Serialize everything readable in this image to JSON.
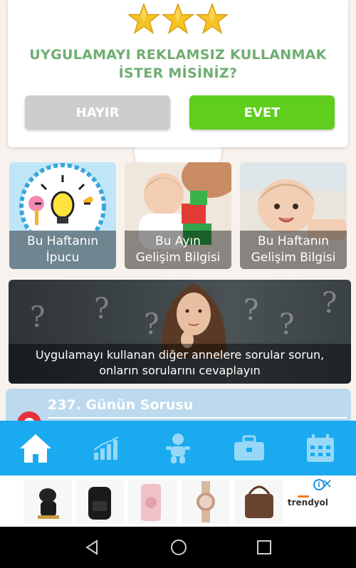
{
  "rating": {
    "star_count": 3,
    "star_color": "#f4c324",
    "question_line1": "UYGULAMAYI REKLAMSIZ KULLANMAK",
    "question_line2": "İSTER MİSİNİZ?",
    "no_label": "HAYIR",
    "yes_label": "EVET"
  },
  "tiles": [
    {
      "line1": "Bu Haftanın",
      "line2": "İpucu",
      "icon": "lightbulb-icon"
    },
    {
      "line1": "Bu Ayın",
      "line2": "Gelişim Bilgisi",
      "icon": "baby-blocks-photo"
    },
    {
      "line1": "Bu Haftanın",
      "line2": "Gelişim Bilgisi",
      "icon": "baby-photo"
    }
  ],
  "banner": {
    "line1": "Uygulamayı kullanan diğer annelere sorular sorun,",
    "line2": "onların sorularını cevaplayın"
  },
  "day_question": {
    "title": "237. Günün Sorusu"
  },
  "nav": {
    "color": "#19aaf0",
    "items": [
      "home-icon",
      "chart-icon",
      "baby-icon",
      "briefcase-icon",
      "calendar-icon"
    ]
  },
  "ad": {
    "brand": "trendyol",
    "info_icon": "info-icon",
    "close_icon": "close-icon"
  },
  "system_nav": [
    "back-icon",
    "home-circle-icon",
    "recents-icon"
  ]
}
